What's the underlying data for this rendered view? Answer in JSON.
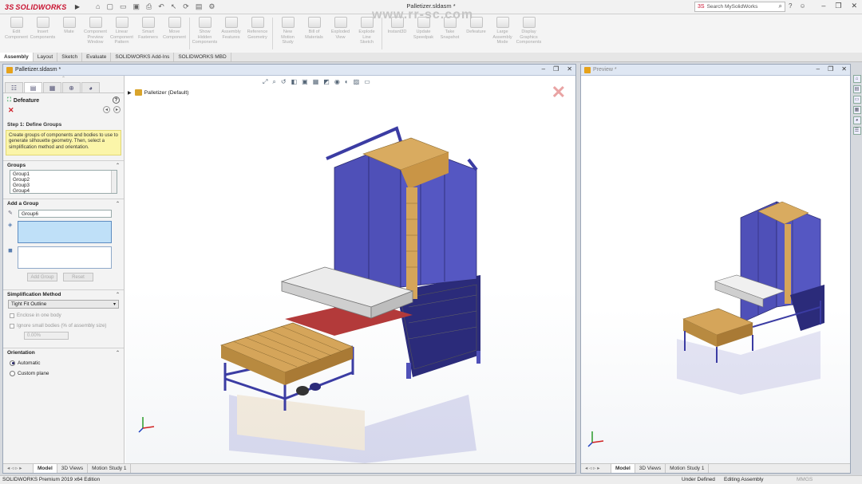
{
  "app": {
    "brand": "SOLIDWORKS",
    "doc_title": "Palletizer.sldasm *",
    "search_placeholder": "Search MySolidWorks",
    "watermark": "www.rr-sc.com"
  },
  "toolbar": [
    {
      "label": "Edit\nComponent",
      "icon": "edit-component-icon"
    },
    {
      "label": "Insert\nComponents",
      "icon": "insert-components-icon"
    },
    {
      "label": "Mate",
      "icon": "mate-icon"
    },
    {
      "label": "Component\nPreview\nWindow",
      "icon": "preview-window-icon"
    },
    {
      "label": "Linear Component\nPattern",
      "icon": "linear-pattern-icon"
    },
    {
      "label": "Smart\nFasteners",
      "icon": "smart-fasteners-icon"
    },
    {
      "label": "Move\nComponent",
      "icon": "move-component-icon"
    },
    {
      "label": "Show\nHidden\nComponents",
      "icon": "show-hidden-icon"
    },
    {
      "label": "Assembly\nFeatures",
      "icon": "assembly-features-icon"
    },
    {
      "label": "Reference\nGeometry",
      "icon": "reference-geometry-icon"
    },
    {
      "label": "New\nMotion\nStudy",
      "icon": "motion-study-icon"
    },
    {
      "label": "Bill of\nMaterials",
      "icon": "bom-icon"
    },
    {
      "label": "Exploded\nView",
      "icon": "exploded-view-icon"
    },
    {
      "label": "Explode\nLine\nSketch",
      "icon": "explode-line-icon"
    },
    {
      "label": "Instant3D",
      "icon": "instant3d-icon"
    },
    {
      "label": "Update\nSpeedpak",
      "icon": "speedpak-icon"
    },
    {
      "label": "Take\nSnapshot",
      "icon": "snapshot-icon"
    },
    {
      "label": "Defeature",
      "icon": "defeature-icon"
    },
    {
      "label": "Large\nAssembly\nMode",
      "icon": "large-assembly-icon"
    },
    {
      "label": "Display\nGraphics\nComponents",
      "icon": "graphics-components-icon"
    }
  ],
  "ribbon_tabs": [
    "Assembly",
    "Layout",
    "Sketch",
    "Evaluate",
    "SOLIDWORKS Add-Ins",
    "SOLIDWORKS MBD"
  ],
  "main_window": {
    "title": "Palletizer.sldasm *"
  },
  "preview_window": {
    "title": "Preview *"
  },
  "property_manager": {
    "title": "Defeature",
    "step": "Step 1: Define Groups",
    "message": "Create groups of components and bodies to use to generate silhouette geometry. Then, select a simplification method and orientation.",
    "groups_header": "Groups",
    "groups": [
      "Group1",
      "Group2",
      "Group3",
      "Group4"
    ],
    "add_group_header": "Add a Group",
    "group_name": "Group6",
    "add_group_btn": "Add Group",
    "reset_btn": "Reset",
    "simplification_header": "Simplification Method",
    "method": "Tight Fit Outline",
    "enclose_label": "Enclose in one body",
    "ignore_label": "Ignore small bodies (% of assembly size)",
    "ignore_value": "0.00%",
    "orientation_header": "Orientation",
    "automatic_label": "Automatic",
    "custom_label": "Custom plane"
  },
  "tree": {
    "root": "Palletizer  (Default)"
  },
  "bottom_tabs": [
    "Model",
    "3D Views",
    "Motion Study 1"
  ],
  "status": {
    "edition": "SOLIDWORKS Premium 2019 x64 Edition",
    "defined": "Under Defined",
    "mode": "Editing Assembly",
    "units": "MMGS"
  },
  "colors": {
    "frame": "#4f50b8",
    "wood": "#d5a55a",
    "cover": "#e6e6e6",
    "accent": "#c8102e"
  }
}
